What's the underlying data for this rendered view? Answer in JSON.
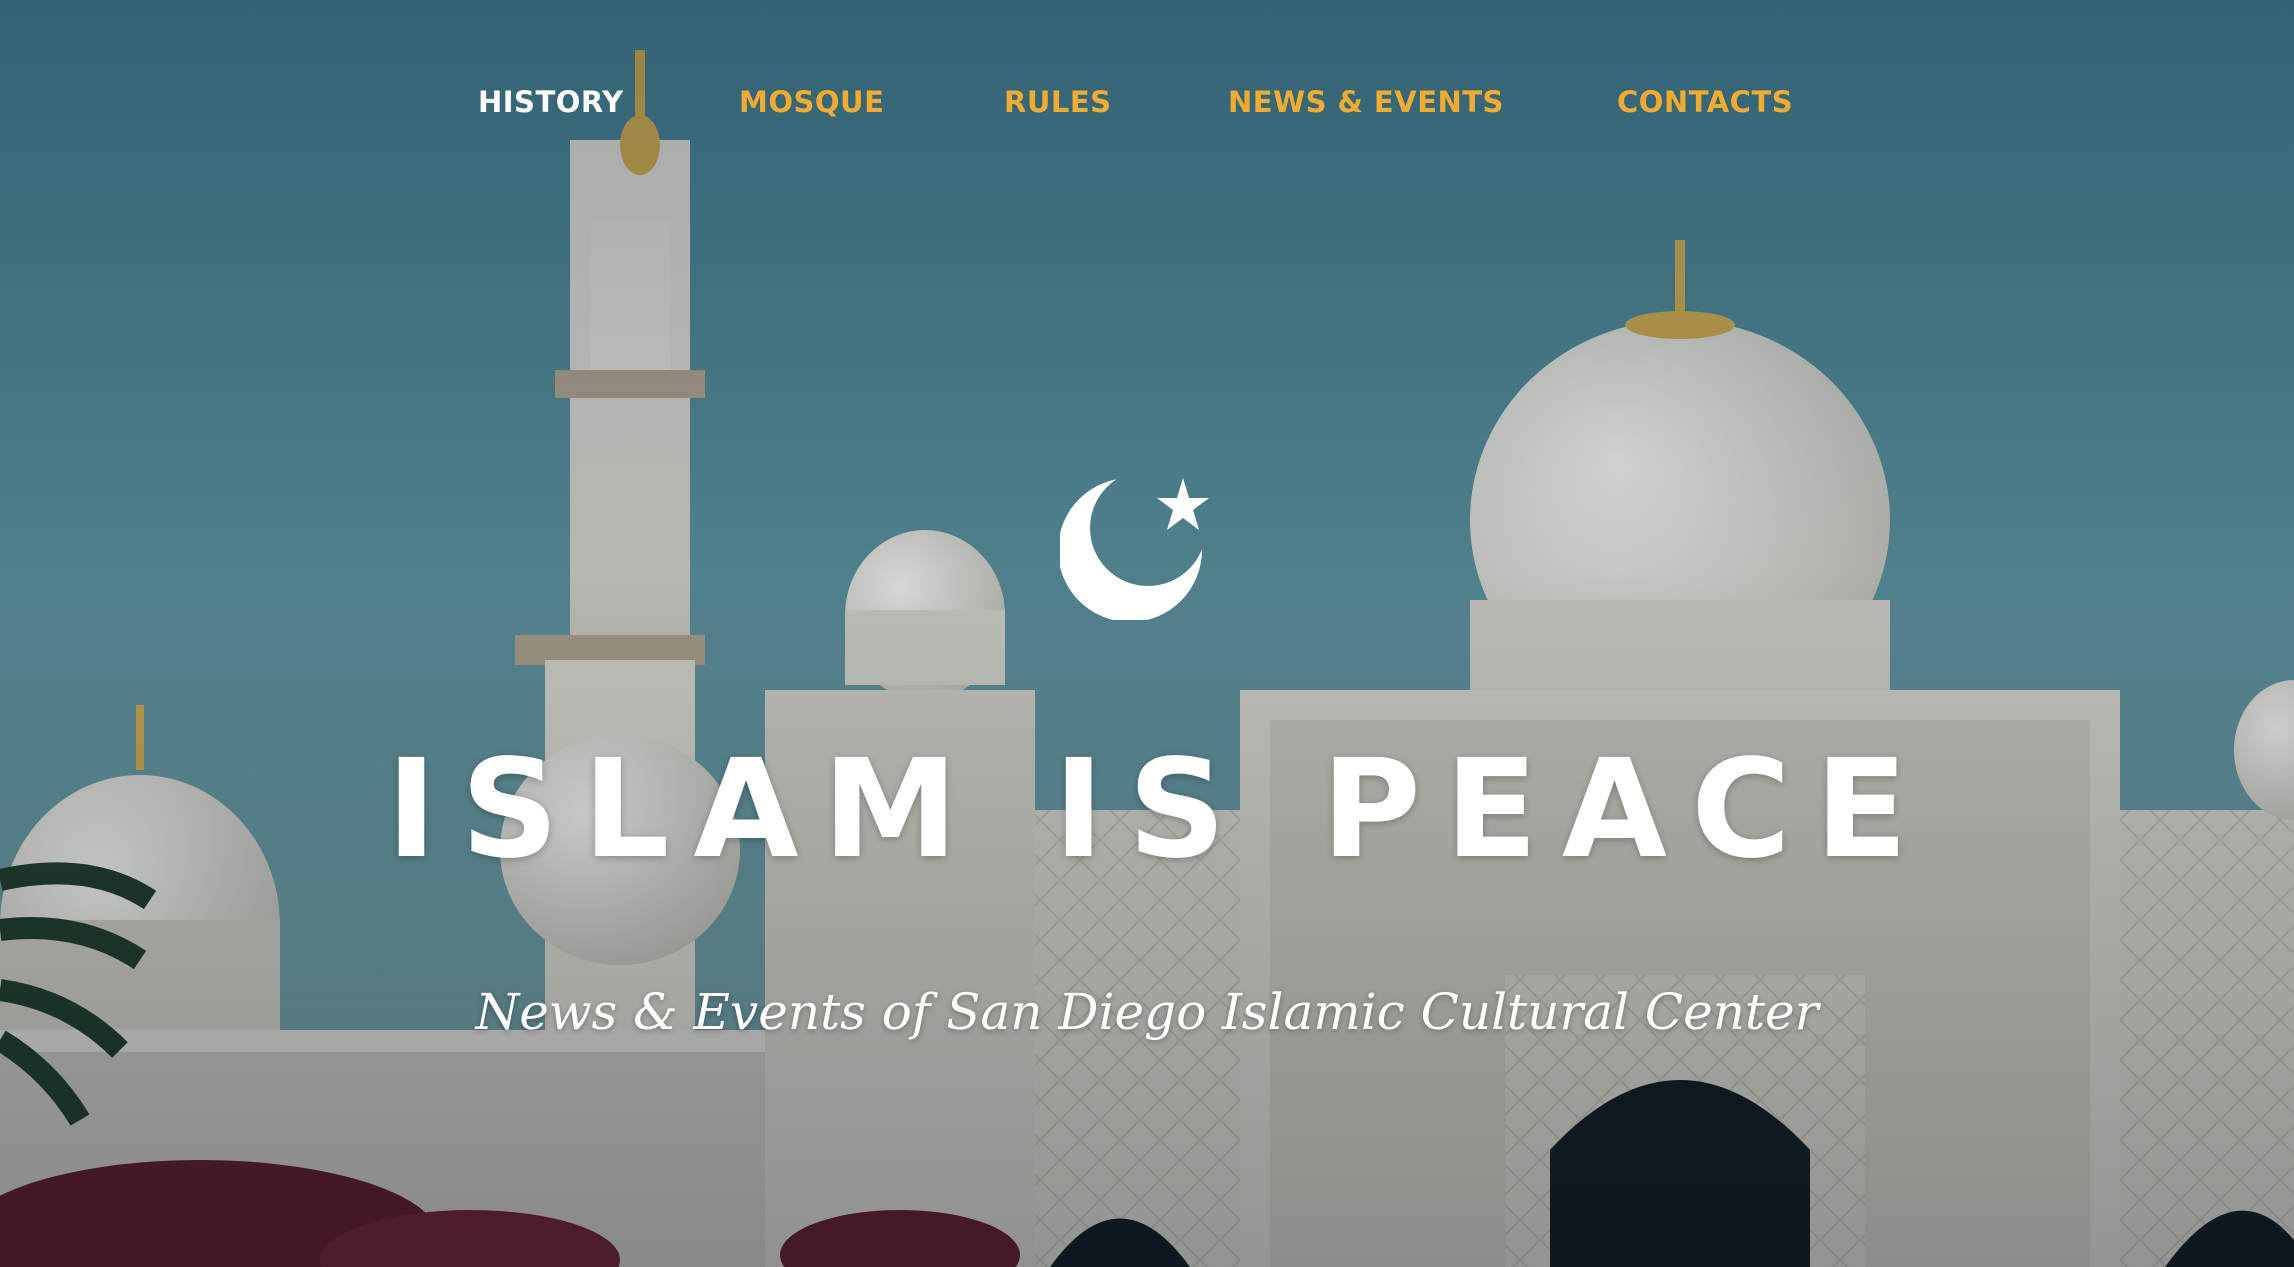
{
  "nav": {
    "items": [
      {
        "label": "HISTORY",
        "active": true
      },
      {
        "label": "MOSQUE",
        "active": false
      },
      {
        "label": "RULES",
        "active": false
      },
      {
        "label": "NEWS & EVENTS",
        "active": false
      },
      {
        "label": "CONTACTS",
        "active": false
      }
    ],
    "active_color": "#ffffff",
    "link_color": "#f0ac32"
  },
  "hero": {
    "logo_icon": "crescent-star-icon",
    "title": "ISLAM IS PEACE",
    "subtitle": "News & Events of San Diego Islamic Cultural Center",
    "background": "mosque-photo-background"
  }
}
